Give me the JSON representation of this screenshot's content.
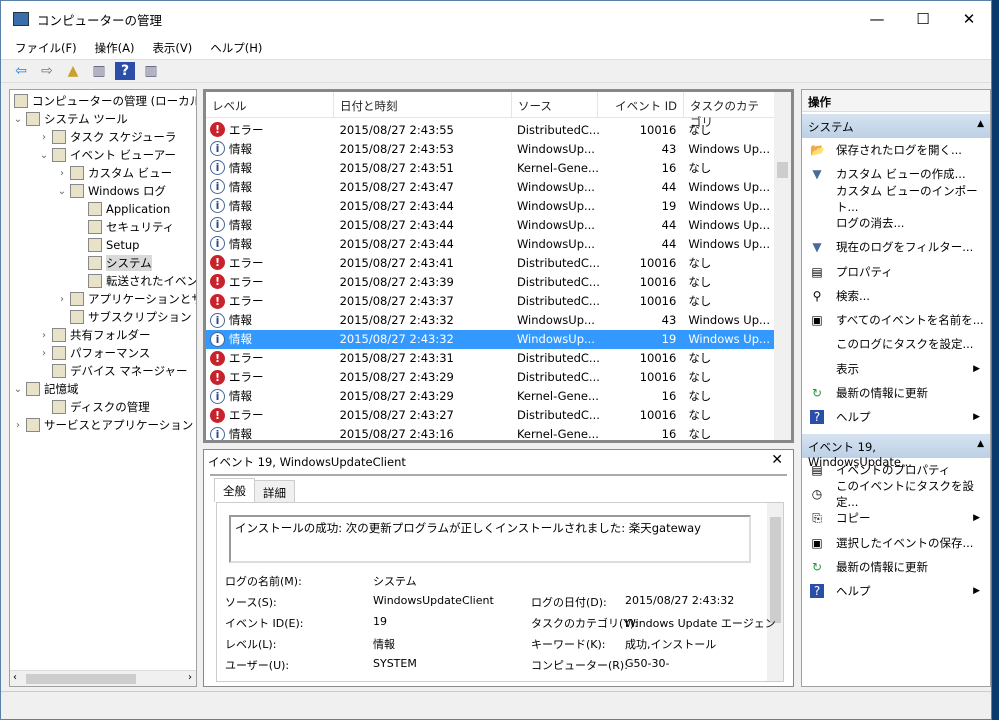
{
  "window": {
    "title": "コンピューターの管理",
    "minimize": "—",
    "maximize": "☐",
    "close": "✕"
  },
  "menu": [
    "ファイル(F)",
    "操作(A)",
    "表示(V)",
    "ヘルプ(H)"
  ],
  "toolbar": [
    {
      "icon": "back-arrow-icon",
      "glyph": "⇦",
      "color": "#2a7dd1"
    },
    {
      "icon": "forward-arrow-icon",
      "glyph": "⇨",
      "color": "#777"
    },
    {
      "icon": "up-folder-icon",
      "glyph": "▲",
      "color": "#c9a227"
    },
    {
      "icon": "show-hide-tree-icon",
      "glyph": "▥",
      "color": "#557"
    },
    {
      "icon": "help-icon",
      "glyph": "?",
      "color": "#fff"
    },
    {
      "icon": "show-hide-action-pane-icon",
      "glyph": "▥",
      "color": "#557"
    }
  ],
  "tree": [
    {
      "label": "コンピューターの管理 (ローカル)",
      "level": 0,
      "expander": ""
    },
    {
      "label": "システム ツール",
      "level": 0,
      "expander": "⌄"
    },
    {
      "label": "タスク スケジューラ",
      "level": 1,
      "expander": "›"
    },
    {
      "label": "イベント ビューアー",
      "level": 1,
      "expander": "⌄"
    },
    {
      "label": "カスタム ビュー",
      "level": 2,
      "expander": "›"
    },
    {
      "label": "Windows ログ",
      "level": 2,
      "expander": "⌄"
    },
    {
      "label": "Application",
      "level": 3,
      "expander": ""
    },
    {
      "label": "セキュリティ",
      "level": 3,
      "expander": ""
    },
    {
      "label": "Setup",
      "level": 3,
      "expander": ""
    },
    {
      "label": "システム",
      "level": 3,
      "expander": "",
      "selected": true
    },
    {
      "label": "転送されたイベント",
      "level": 3,
      "expander": ""
    },
    {
      "label": "アプリケーションとサービス",
      "level": 2,
      "expander": "›"
    },
    {
      "label": "サブスクリプション",
      "level": 2,
      "expander": ""
    },
    {
      "label": "共有フォルダー",
      "level": 1,
      "expander": "›"
    },
    {
      "label": "パフォーマンス",
      "level": 1,
      "expander": "›"
    },
    {
      "label": "デバイス マネージャー",
      "level": 1,
      "expander": ""
    },
    {
      "label": "記憶域",
      "level": 0,
      "expander": "⌄"
    },
    {
      "label": "ディスクの管理",
      "level": 1,
      "expander": ""
    },
    {
      "label": "サービスとアプリケーション",
      "level": 0,
      "expander": "›"
    }
  ],
  "events": {
    "columns": [
      "レベル",
      "日付と時刻",
      "ソース",
      "イベント ID",
      "タスクのカテゴリ"
    ],
    "rows": [
      [
        "error",
        "エラー",
        "2015/08/27 2:43:55",
        "DistributedC...",
        "10016",
        "なし"
      ],
      [
        "info",
        "情報",
        "2015/08/27 2:43:53",
        "WindowsUp...",
        "43",
        "Windows Up..."
      ],
      [
        "info",
        "情報",
        "2015/08/27 2:43:51",
        "Kernel-Gene...",
        "16",
        "なし"
      ],
      [
        "info",
        "情報",
        "2015/08/27 2:43:47",
        "WindowsUp...",
        "44",
        "Windows Up..."
      ],
      [
        "info",
        "情報",
        "2015/08/27 2:43:44",
        "WindowsUp...",
        "19",
        "Windows Up..."
      ],
      [
        "info",
        "情報",
        "2015/08/27 2:43:44",
        "WindowsUp...",
        "44",
        "Windows Up..."
      ],
      [
        "info",
        "情報",
        "2015/08/27 2:43:44",
        "WindowsUp...",
        "44",
        "Windows Up..."
      ],
      [
        "error",
        "エラー",
        "2015/08/27 2:43:41",
        "DistributedC...",
        "10016",
        "なし"
      ],
      [
        "error",
        "エラー",
        "2015/08/27 2:43:39",
        "DistributedC...",
        "10016",
        "なし"
      ],
      [
        "error",
        "エラー",
        "2015/08/27 2:43:37",
        "DistributedC...",
        "10016",
        "なし"
      ],
      [
        "info",
        "情報",
        "2015/08/27 2:43:32",
        "WindowsUp...",
        "43",
        "Windows Up..."
      ],
      [
        "info",
        "情報",
        "2015/08/27 2:43:32",
        "WindowsUp...",
        "19",
        "Windows Up..."
      ],
      [
        "error",
        "エラー",
        "2015/08/27 2:43:31",
        "DistributedC...",
        "10016",
        "なし"
      ],
      [
        "error",
        "エラー",
        "2015/08/27 2:43:29",
        "DistributedC...",
        "10016",
        "なし"
      ],
      [
        "info",
        "情報",
        "2015/08/27 2:43:29",
        "Kernel-Gene...",
        "16",
        "なし"
      ],
      [
        "error",
        "エラー",
        "2015/08/27 2:43:27",
        "DistributedC...",
        "10016",
        "なし"
      ],
      [
        "info",
        "情報",
        "2015/08/27 2:43:16",
        "Kernel-Gene...",
        "16",
        "なし"
      ]
    ],
    "selected_index": 11
  },
  "detail": {
    "title": "イベント 19, WindowsUpdateClient",
    "close": "✕",
    "tabs": [
      "全般",
      "詳細"
    ],
    "message": "インストールの成功: 次の更新プログラムが正しくインストールされました: 楽天gateway",
    "fields": [
      {
        "label": "ログの名前(M):",
        "value": "システム"
      },
      {
        "label": "ソース(S):",
        "value": "WindowsUpdateClient",
        "label2": "ログの日付(D):",
        "value2": "2015/08/27 2:43:32"
      },
      {
        "label": "イベント ID(E):",
        "value": "19",
        "label2": "タスクのカテゴリ(Y):",
        "value2": "Windows Update エージェン"
      },
      {
        "label": "レベル(L):",
        "value": "情報",
        "label2": "キーワード(K):",
        "value2": "成功,インストール"
      },
      {
        "label": "ユーザー(U):",
        "value": "SYSTEM",
        "label2": "コンピューター(R):",
        "value2": "G50-30-"
      }
    ]
  },
  "actions": {
    "header": "操作",
    "sections": [
      {
        "title": "システム",
        "items": [
          {
            "label": "保存されたログを開く...",
            "icon": "open-folder-icon",
            "glyph": "📂"
          },
          {
            "label": "カスタム ビューの作成...",
            "icon": "filter-icon",
            "glyph": "▼"
          },
          {
            "label": "カスタム ビューのインポート...",
            "icon": "",
            "glyph": ""
          },
          {
            "label": "ログの消去...",
            "icon": "",
            "glyph": ""
          },
          {
            "label": "現在のログをフィルター...",
            "icon": "filter-icon",
            "glyph": "▼"
          },
          {
            "label": "プロパティ",
            "icon": "properties-icon",
            "glyph": "▤"
          },
          {
            "label": "検索...",
            "icon": "find-icon",
            "glyph": "⚲"
          },
          {
            "label": "すべてのイベントを名前を...",
            "icon": "save-icon",
            "glyph": "▣"
          },
          {
            "label": "このログにタスクを設定...",
            "icon": "",
            "glyph": ""
          },
          {
            "label": "表示",
            "icon": "",
            "glyph": "",
            "submenu": true
          },
          {
            "label": "最新の情報に更新",
            "icon": "refresh-icon",
            "glyph": "↻"
          },
          {
            "label": "ヘルプ",
            "icon": "help-icon",
            "glyph": "?",
            "submenu": true
          }
        ]
      },
      {
        "title": "イベント 19, WindowsUpdate...",
        "items": [
          {
            "label": "イベントのプロパティ",
            "icon": "properties-icon",
            "glyph": "▤"
          },
          {
            "label": "このイベントにタスクを設定...",
            "icon": "task-clock-icon",
            "glyph": "◷"
          },
          {
            "label": "コピー",
            "icon": "copy-icon",
            "glyph": "⎘",
            "submenu": true
          },
          {
            "label": "選択したイベントの保存...",
            "icon": "save-icon",
            "glyph": "▣"
          },
          {
            "label": "最新の情報に更新",
            "icon": "refresh-icon",
            "glyph": "↻"
          },
          {
            "label": "ヘルプ",
            "icon": "help-icon",
            "glyph": "?",
            "submenu": true
          }
        ]
      }
    ]
  }
}
